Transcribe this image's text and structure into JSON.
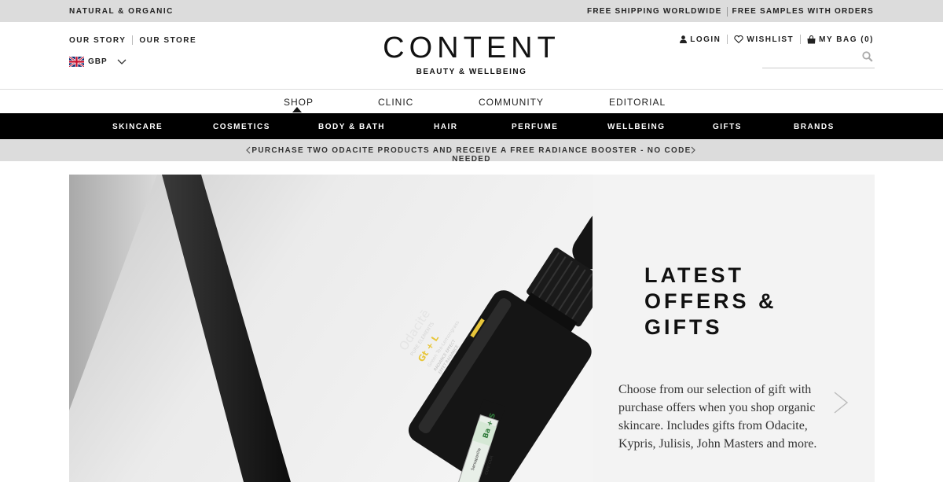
{
  "topbar": {
    "left": "NATURAL & ORGANIC",
    "right": [
      "FREE SHIPPING WORLDWIDE",
      "FREE SAMPLES WITH ORDERS"
    ]
  },
  "header": {
    "links": [
      "OUR STORY",
      "OUR STORE"
    ],
    "currency": "GBP",
    "logo": "CONTENT",
    "tagline": "BEAUTY & WELLBEING",
    "login": "LOGIN",
    "wishlist": "WISHLIST",
    "bag": "MY BAG (0)",
    "search_placeholder": ""
  },
  "mainnav": [
    "SHOP",
    "CLINIC",
    "COMMUNITY",
    "EDITORIAL"
  ],
  "catnav": [
    "SKINCARE",
    "COSMETICS",
    "BODY & BATH",
    "HAIR",
    "PERFUME",
    "WELLBEING",
    "GIFTS",
    "BRANDS"
  ],
  "promo": "PURCHASE TWO ODACITE PRODUCTS AND RECEIVE A FREE RADIANCE BOOSTER - NO CODE NEEDED",
  "hero": {
    "title": "LATEST\nOFFERS &\nGIFTS",
    "description": "Choose from our selection of gift with purchase offers when you shop organic skincare. Includes gifts from Odacite, Kypris, Julisis, John Masters and more.",
    "product": {
      "brand": "Odacitē",
      "line": "PURE ELEMENTS",
      "code": "Gt + L",
      "name": "Green Tea-Lemongrass",
      "effect": "RADIANCE EFFECT",
      "effect_fr": "EFFET RADIANCE",
      "vial_code": "Ba + S",
      "vial_name": "Sarsaparilla",
      "vial_effect": "CONTOUR"
    }
  },
  "colors": {
    "black": "#000000",
    "bar_grey": "#dcdcdc",
    "accent_yellow": "#e8c63a"
  }
}
